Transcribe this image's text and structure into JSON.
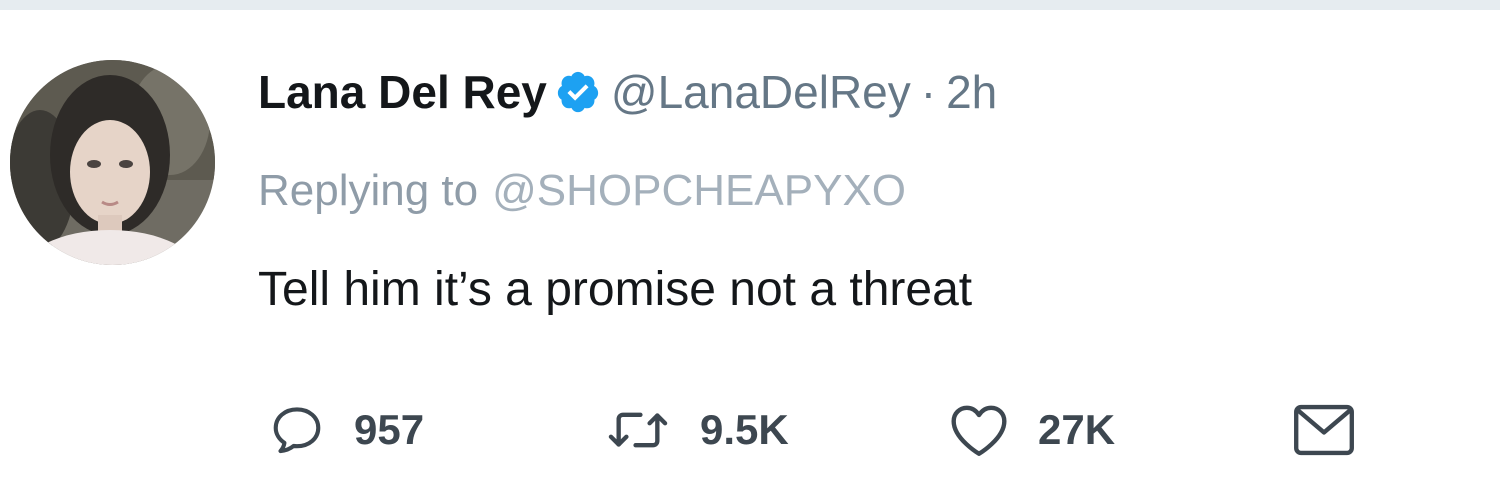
{
  "tweet": {
    "author": {
      "name": "Lana Del Rey",
      "handle": "@LanaDelRey",
      "verified": true,
      "avatar_icon": "avatar-photo"
    },
    "separator": "·",
    "timestamp": "2h",
    "reply": {
      "prefix": "Replying to",
      "target": "@SHOPCHEAPYXO"
    },
    "text": "Tell him it’s a promise not a threat",
    "actions": {
      "reply": {
        "icon": "reply-icon",
        "count": "957"
      },
      "retweet": {
        "icon": "retweet-icon",
        "count": "9.5K"
      },
      "like": {
        "icon": "heart-icon",
        "count": "27K"
      },
      "dm": {
        "icon": "mail-icon"
      }
    }
  },
  "colors": {
    "text": "#14171a",
    "secondary": "#657786",
    "verified": "#1da1f2",
    "divider": "#e6ecf0"
  }
}
